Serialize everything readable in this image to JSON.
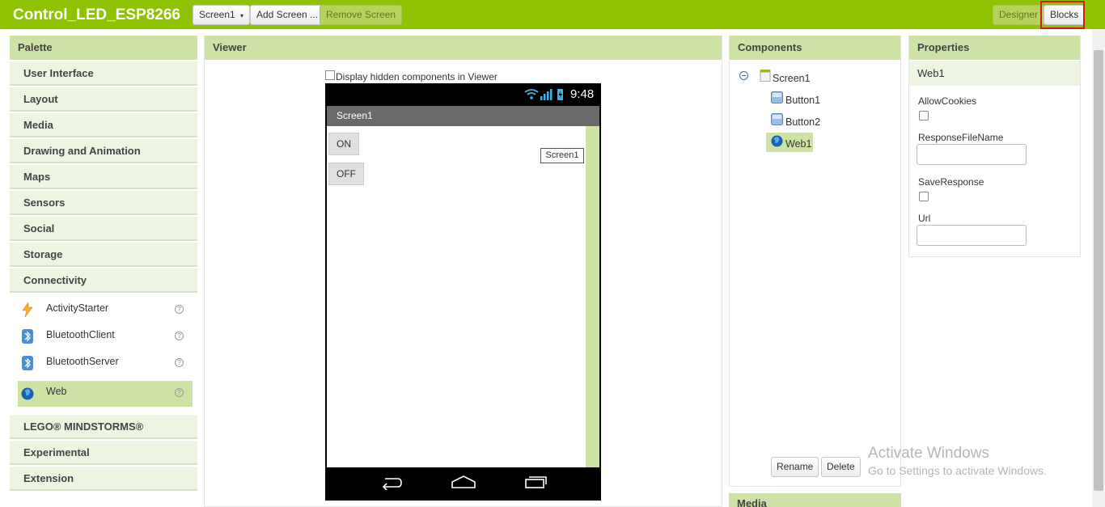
{
  "app": {
    "title": "Control_LED_ESP8266"
  },
  "toolbar": {
    "screen_select": "Screen1",
    "add_screen": "Add Screen ...",
    "remove_screen": "Remove Screen",
    "designer": "Designer",
    "blocks": "Blocks"
  },
  "palette": {
    "title": "Palette",
    "categories_top": [
      "User Interface",
      "Layout",
      "Media",
      "Drawing and Animation",
      "Maps",
      "Sensors",
      "Social",
      "Storage",
      "Connectivity"
    ],
    "connectivity_items": [
      {
        "label": "ActivityStarter",
        "icon": "lightning-icon"
      },
      {
        "label": "BluetoothClient",
        "icon": "bluetooth-icon"
      },
      {
        "label": "BluetoothServer",
        "icon": "bluetooth-icon"
      },
      {
        "label": "Web",
        "icon": "globe-icon",
        "selected": true
      }
    ],
    "categories_bottom": [
      "LEGO® MINDSTORMS®",
      "Experimental",
      "Extension"
    ]
  },
  "viewer": {
    "title": "Viewer",
    "hidden_checkbox_label": "Display hidden components in Viewer",
    "phone_time": "9:48",
    "screen_title": "Screen1",
    "button_on": "ON",
    "button_off": "OFF",
    "screen_tag": "Screen1"
  },
  "components": {
    "title": "Components",
    "tree": [
      {
        "label": "Screen1"
      },
      {
        "label": "Button1"
      },
      {
        "label": "Button2"
      },
      {
        "label": "Web1",
        "selected": true
      }
    ],
    "rename": "Rename",
    "delete": "Delete",
    "media_title": "Media"
  },
  "properties": {
    "title": "Properties",
    "component": "Web1",
    "allow_cookies": "AllowCookies",
    "response_file_name": "ResponseFileName",
    "save_response": "SaveResponse",
    "url": "Url"
  },
  "watermark": {
    "line1": "Activate Windows",
    "line2": "Go to Settings to activate Windows."
  },
  "colors": {
    "accent": "#8fc202",
    "panel_header": "#cfe2a6",
    "highlight": "#d21a1a"
  }
}
